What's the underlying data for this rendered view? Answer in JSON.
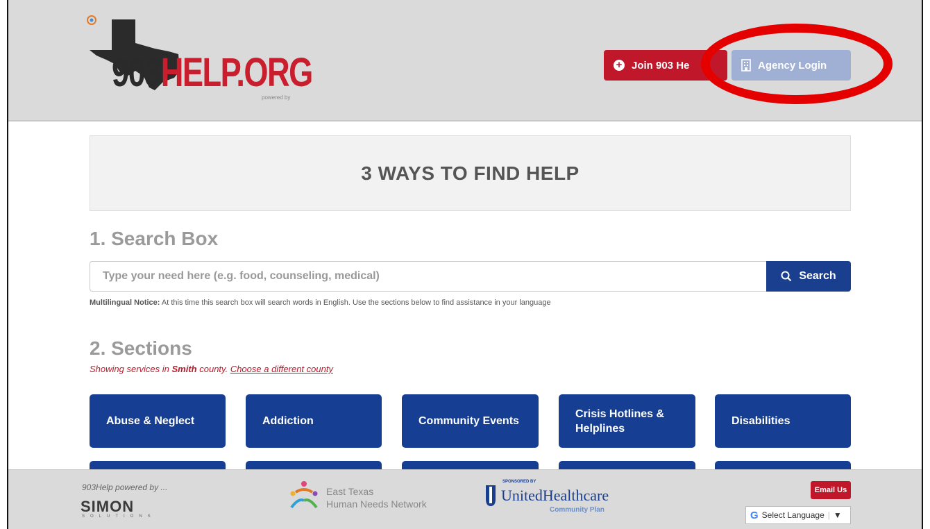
{
  "header": {
    "logo_number": "903",
    "logo_text": "HELP.ORG",
    "logo_powered": "powered by",
    "join_label": "Join 903 He",
    "agency_label": "Agency Login"
  },
  "banner": {
    "title": "3 WAYS TO FIND HELP"
  },
  "search": {
    "heading": "1. Search Box",
    "placeholder": "Type your need here (e.g. food, counseling, medical)",
    "button_label": "Search",
    "notice_label": "Multilingual Notice:",
    "notice_text": " At this time this search box will search words in English. Use the sections below to find assistance in your language"
  },
  "sections": {
    "heading": "2. Sections",
    "county_prefix": "Showing services in ",
    "county_name": "Smith",
    "county_suffix": " county. ",
    "county_link": "Choose a different county",
    "items": [
      {
        "label": "Abuse & Neglect"
      },
      {
        "label": "Addiction"
      },
      {
        "label": "Community Events"
      },
      {
        "label": "Crisis Hotlines & Helplines"
      },
      {
        "label": "Disabilities"
      }
    ]
  },
  "footer": {
    "powered_by": "903Help powered by ...",
    "simon": "SIMON",
    "simon_sub": "SOLUTIONS",
    "etx_line1": "East Texas",
    "etx_line2": "Human Needs Network",
    "uhc_sponsored": "SPONSORED BY",
    "uhc_name": "UnitedHealthcare",
    "uhc_plan": "Community Plan",
    "email_label": "Email Us",
    "language_label": "Select Language",
    "language_arrow": "▼"
  },
  "colors": {
    "brand_red": "#c0182a",
    "brand_blue": "#163f93",
    "agency_button": "#9fb0d4",
    "annotation_circle": "#e50000"
  },
  "icons": [
    "plus-circle-icon",
    "building-icon",
    "search-icon",
    "google-icon"
  ]
}
